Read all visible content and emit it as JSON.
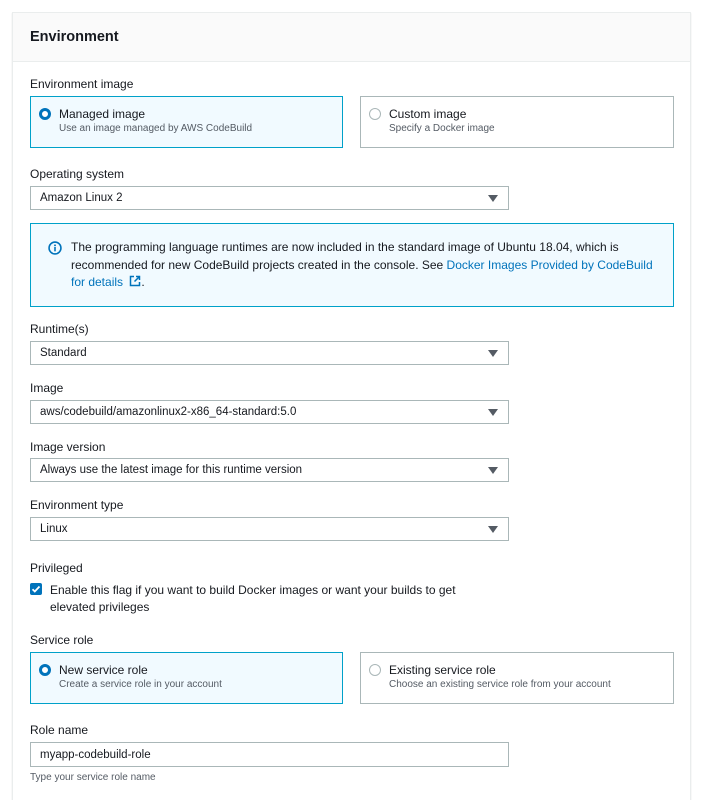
{
  "section": {
    "title": "Environment"
  },
  "environment_image": {
    "label": "Environment image",
    "options": [
      {
        "title": "Managed image",
        "description": "Use an image managed by AWS CodeBuild",
        "selected": true
      },
      {
        "title": "Custom image",
        "description": "Specify a Docker image",
        "selected": false
      }
    ]
  },
  "operating_system": {
    "label": "Operating system",
    "value": "Amazon Linux 2"
  },
  "info_alert": {
    "text_before": "The programming language runtimes are now included in the standard image of Ubuntu 18.04, which is recommended for new CodeBuild projects created in the console. See ",
    "link_text": "Docker Images Provided by CodeBuild for details",
    "text_after": ".",
    "icon": "info-icon",
    "external_icon": "external-link-icon"
  },
  "runtimes": {
    "label": "Runtime(s)",
    "value": "Standard"
  },
  "image": {
    "label": "Image",
    "value": "aws/codebuild/amazonlinux2-x86_64-standard:5.0"
  },
  "image_version": {
    "label": "Image version",
    "value": "Always use the latest image for this runtime version"
  },
  "environment_type": {
    "label": "Environment type",
    "value": "Linux"
  },
  "privileged": {
    "label": "Privileged",
    "checkbox_label": "Enable this flag if you want to build Docker images or want your builds to get elevated privileges",
    "checked": true
  },
  "service_role": {
    "label": "Service role",
    "options": [
      {
        "title": "New service role",
        "description": "Create a service role in your account",
        "selected": true
      },
      {
        "title": "Existing service role",
        "description": "Choose an existing service role from your account",
        "selected": false
      }
    ]
  },
  "role_name": {
    "label": "Role name",
    "value": "myapp-codebuild-role",
    "hint": "Type your service role name"
  },
  "colors": {
    "accent": "#0073bb",
    "selected_border": "#00a1c9",
    "selected_bg": "#f1faff",
    "border": "#aab7b8"
  }
}
